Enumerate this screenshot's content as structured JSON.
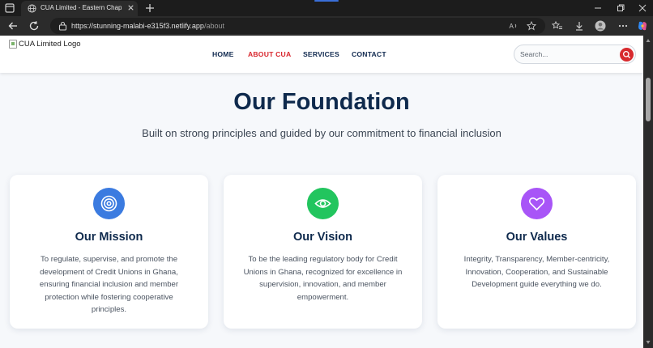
{
  "browser": {
    "tab_title": "CUA Limited - Eastern Chapter | E",
    "url_host": "https://stunning-malabi-e315f3.netlify.app",
    "url_path": "/about"
  },
  "site": {
    "logo_alt": "CUA Limited Logo",
    "nav": [
      {
        "label": "HOME",
        "active": false
      },
      {
        "label": "ABOUT CUA",
        "active": true
      },
      {
        "label": "SERVICES",
        "active": false
      },
      {
        "label": "CONTACT",
        "active": false
      }
    ],
    "search_placeholder": "Search...",
    "colors": {
      "brand_navy": "#0f2a4d",
      "accent_red": "#d82a2e"
    }
  },
  "hero": {
    "title": "Our Foundation",
    "subtitle": "Built on strong principles and guided by our commitment to financial inclusion"
  },
  "cards": [
    {
      "title": "Our Mission",
      "icon": "target-icon",
      "color": "#3b7be0",
      "text": "To regulate, supervise, and promote the development of Credit Unions in Ghana, ensuring financial inclusion and member protection while fostering cooperative principles."
    },
    {
      "title": "Our Vision",
      "icon": "eye-icon",
      "color": "#22c55e",
      "text": "To be the leading regulatory body for Credit Unions in Ghana, recognized for excellence in supervision, innovation, and member empowerment."
    },
    {
      "title": "Our Values",
      "icon": "heart-icon",
      "color": "#a855f7",
      "text": "Integrity, Transparency, Member-centricity, Innovation, Cooperation, and Sustainable Development guide everything we do."
    }
  ]
}
